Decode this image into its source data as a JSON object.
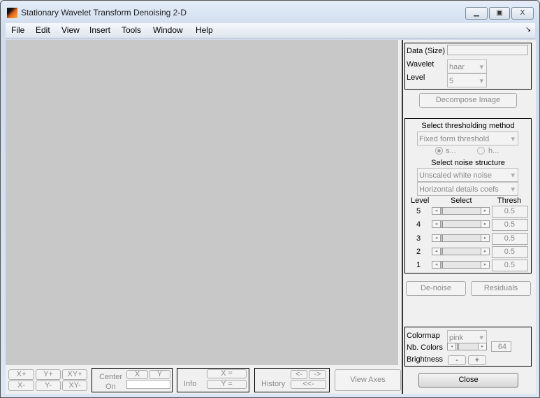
{
  "window": {
    "title": "Stationary Wavelet Transform Denoising 2-D",
    "minimize": "▁",
    "maximize": "▣",
    "close": "X"
  },
  "menu": [
    "File",
    "Edit",
    "View",
    "Insert",
    "Tools",
    "Window",
    "Help"
  ],
  "menu_arrow": "↘",
  "data_panel": {
    "data_label": "Data  (Size)",
    "data_value": "",
    "wavelet_label": "Wavelet",
    "wavelet_value": "haar",
    "level_label": "Level",
    "level_value": "5"
  },
  "decompose_button": "Decompose Image",
  "threshold_panel": {
    "method_title": "Select thresholding method",
    "method_value": "Fixed form threshold",
    "soft": "s...",
    "hard": "h...",
    "noise_title": "Select noise structure",
    "noise_value": "Unscaled white noise",
    "coefs_value": "Horizontal details coefs",
    "col_level": "Level",
    "col_select": "Select",
    "col_thresh": "Thresh",
    "rows": [
      {
        "level": "5",
        "thresh": "0.5"
      },
      {
        "level": "4",
        "thresh": "0.5"
      },
      {
        "level": "3",
        "thresh": "0.5"
      },
      {
        "level": "2",
        "thresh": "0.5"
      },
      {
        "level": "1",
        "thresh": "0.5"
      }
    ]
  },
  "denoise_button": "De-noise",
  "residuals_button": "Residuals",
  "color_panel": {
    "colormap_label": "Colormap",
    "colormap_value": "pink",
    "nb_colors_label": "Nb. Colors",
    "nb_colors_value": "64",
    "brightness_label": "Brightness",
    "minus": "-",
    "plus": "+"
  },
  "close_button": "Close",
  "bottom": {
    "xp": "X+",
    "yp": "Y+",
    "xyp": "XY+",
    "xm": "X-",
    "ym": "Y-",
    "xym": "XY-",
    "center": "Center",
    "on": "On",
    "x": "X",
    "y": "Y",
    "info": "Info",
    "xeq": "X =",
    "yeq": "Y =",
    "history": "History",
    "back": "<-",
    "fwd": "->",
    "first": "<<-",
    "view_axes": "View Axes"
  }
}
